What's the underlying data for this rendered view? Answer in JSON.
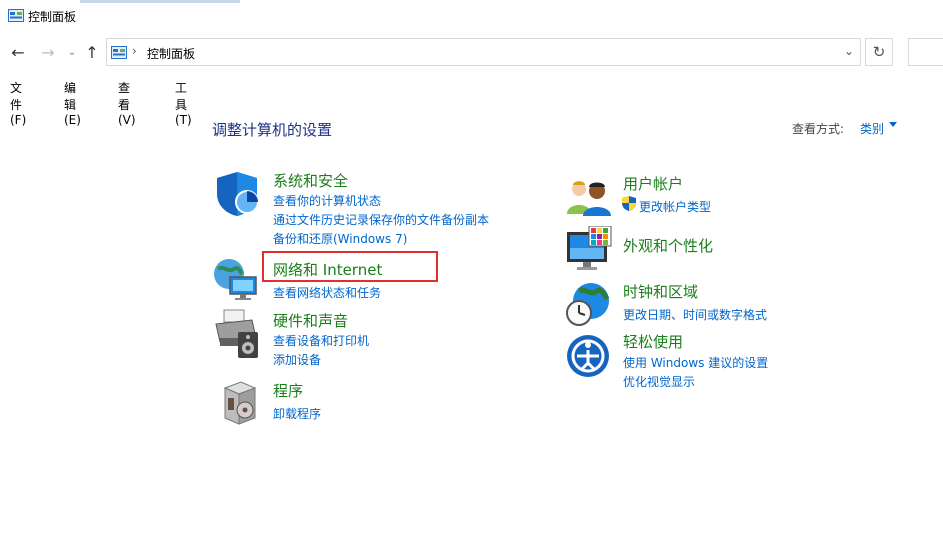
{
  "window": {
    "title": "控制面板"
  },
  "address": {
    "path": "控制面板"
  },
  "menu": [
    "文件(F)",
    "编辑(E)",
    "查看(V)",
    "工具(T)"
  ],
  "heading": "调整计算机的设置",
  "view_by": {
    "label": "查看方式:",
    "value": "类别"
  },
  "categories": {
    "system": {
      "title": "系统和安全",
      "links": [
        "查看你的计算机状态",
        "通过文件历史记录保存你的文件备份副本",
        "备份和还原(Windows 7)"
      ]
    },
    "network": {
      "title": "网络和 Internet",
      "links": [
        "查看网络状态和任务"
      ]
    },
    "hardware": {
      "title": "硬件和声音",
      "links": [
        "查看设备和打印机",
        "添加设备"
      ]
    },
    "programs": {
      "title": "程序",
      "links": [
        "卸载程序"
      ]
    },
    "users": {
      "title": "用户帐户",
      "links": [
        "更改帐户类型"
      ]
    },
    "appearance": {
      "title": "外观和个性化",
      "links": []
    },
    "clock": {
      "title": "时钟和区域",
      "links": [
        "更改日期、时间或数字格式"
      ]
    },
    "ease": {
      "title": "轻松使用",
      "links": [
        "使用 Windows 建议的设置",
        "优化视觉显示"
      ]
    }
  },
  "colors": {
    "accent_link": "#0066cc",
    "category_title": "#1a7f1a",
    "heading": "#1e3287",
    "highlight": "#e03030"
  }
}
